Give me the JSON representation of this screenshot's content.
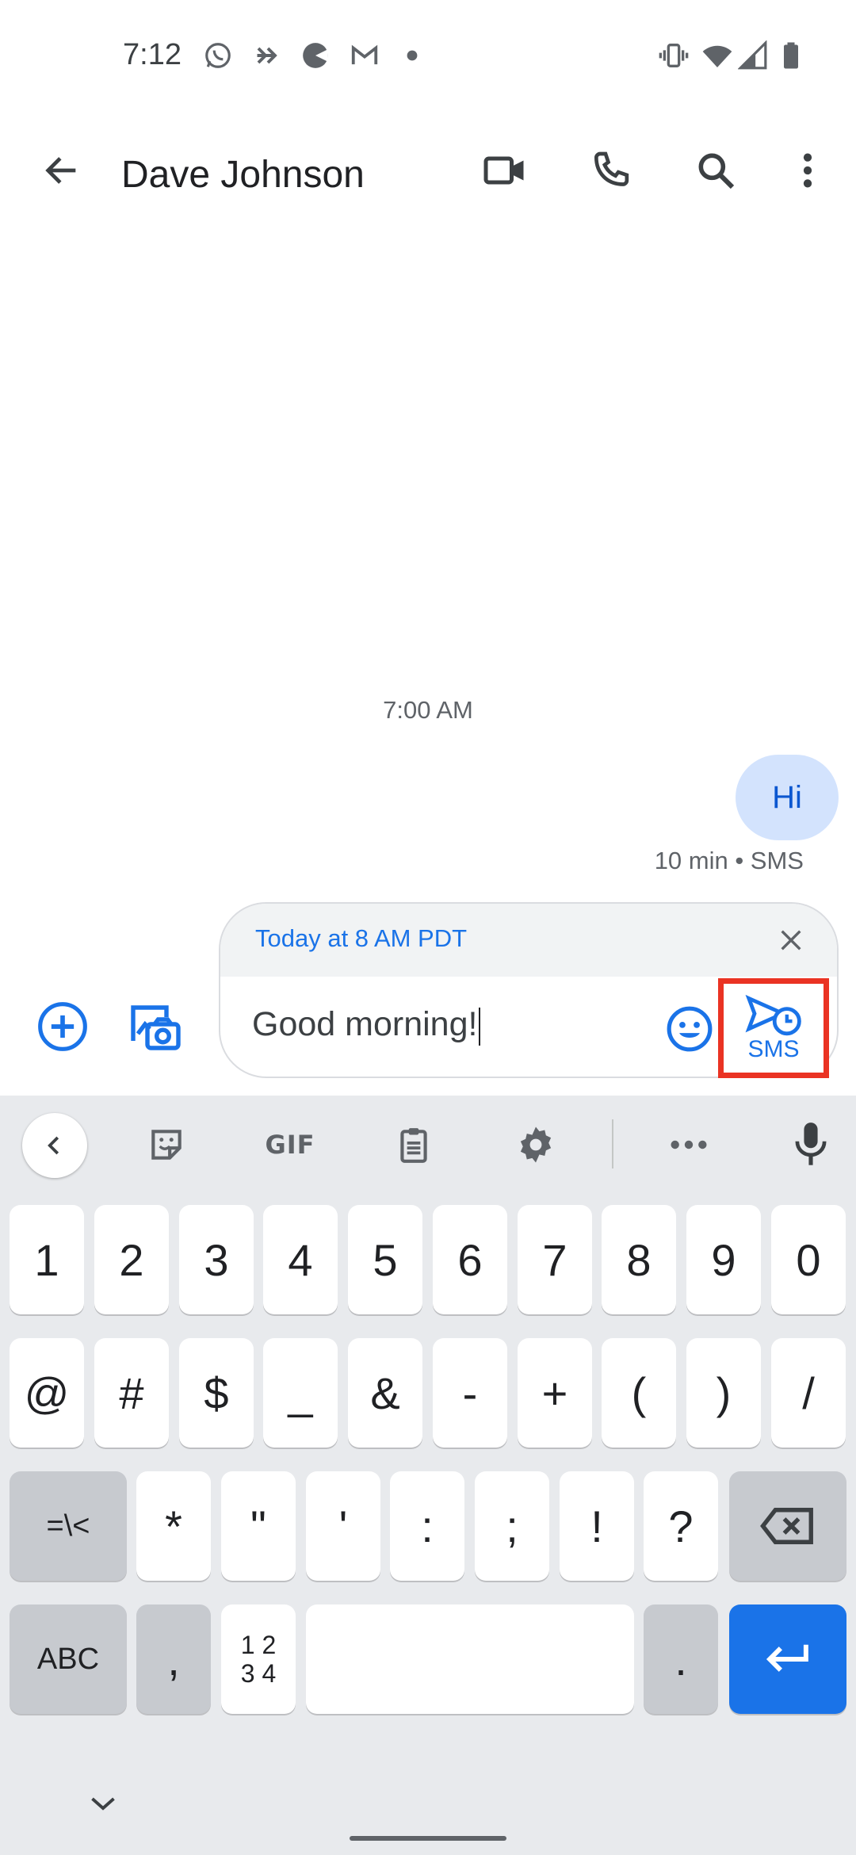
{
  "status_bar": {
    "time": "7:12",
    "left_icons": [
      "whatsapp-icon",
      "forward-arrow-icon",
      "pacman-app-icon",
      "gmail-icon",
      "dot-icon"
    ],
    "right_icons": [
      "vibrate-icon",
      "wifi-icon",
      "signal-icon",
      "battery-icon"
    ]
  },
  "app_bar": {
    "contact_name": "Dave Johnson",
    "actions": [
      "video-call-icon",
      "phone-icon",
      "search-icon",
      "more-vert-icon"
    ]
  },
  "conversation": {
    "timestamp": "7:00 AM",
    "messages": [
      {
        "text": "Hi",
        "meta": "10 min • SMS",
        "direction": "outgoing"
      }
    ]
  },
  "composer": {
    "schedule_label": "Today at 8 AM PDT",
    "text": "Good morning!",
    "send_label": "SMS",
    "accent_color": "#1a73e8",
    "highlight_color": "#ea3323"
  },
  "keyboard": {
    "toolbar": [
      "back-chevron-icon",
      "sticker-icon",
      "GIF",
      "clipboard-icon",
      "settings-icon",
      "more-horiz-icon",
      "mic-icon"
    ],
    "gif_label": "GIF",
    "row1": [
      "1",
      "2",
      "3",
      "4",
      "5",
      "6",
      "7",
      "8",
      "9",
      "0"
    ],
    "row2": [
      "@",
      "#",
      "$",
      "_",
      "&",
      "-",
      "+",
      "(",
      ")",
      "/"
    ],
    "row3": {
      "shift": "=\\<",
      "keys": [
        "*",
        "\"",
        "'",
        ":",
        ";",
        "!",
        "?"
      ]
    },
    "row4": {
      "abc": "ABC",
      "comma": ",",
      "numpad": "1 2\n3 4",
      "period": "."
    }
  }
}
